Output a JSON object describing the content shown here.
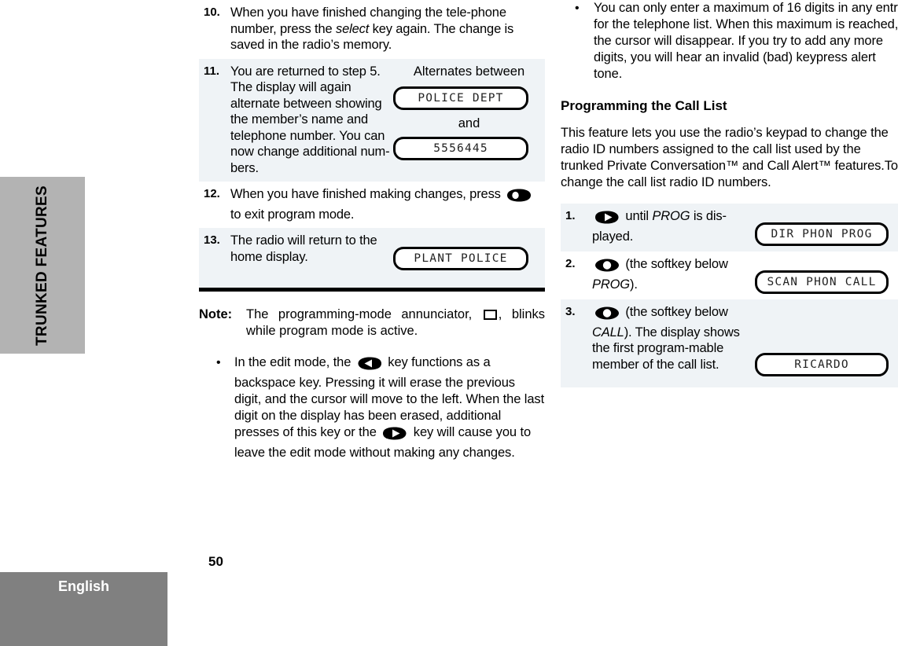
{
  "side_tab": {
    "label": "TRUNKED FEATURES"
  },
  "footer": {
    "language": "English",
    "page_number": "50"
  },
  "left_column": {
    "steps": [
      {
        "number": "10.",
        "shaded": false,
        "text_a": "When you have finished changing the tele-phone number, press the ",
        "text_italic": "select",
        "text_b": " key again. The change is saved in the radio’s memory."
      },
      {
        "number": "11.",
        "shaded": true,
        "text": "You are returned to step 5. The display will again alternate between showing the member’s name and telephone number. You can now change additional num-bers.",
        "aux_caption": "Alternates between",
        "lcd_1": "POLICE DEPT",
        "aux_and": "and",
        "lcd_2": "5556445"
      },
      {
        "number": "12.",
        "shaded": false,
        "text_a": "When you have finished making changes, press ",
        "icon": "home-key-icon",
        "text_b": " to exit program mode."
      },
      {
        "number": "13.",
        "shaded": true,
        "text": "The radio will return to the home display.",
        "lcd_1": "PLANT POLICE"
      }
    ],
    "note": {
      "label": "Note:",
      "text_a": "The programming-mode annunciator, ",
      "icon": "annunciator-icon",
      "text_b": ", blinks while program mode is active."
    },
    "bullet": {
      "mark": "•",
      "text_a": "In the edit mode, the ",
      "icon_1": "left-arrow-key-icon",
      "text_b": " key functions as a backspace key. Pressing it will erase the previous digit, and the cursor will move to the left. When the last digit on the display has been erased, additional presses of this key or the ",
      "icon_2": "right-arrow-key-icon",
      "text_c": " key will cause you to leave the edit mode without making any changes."
    }
  },
  "right_column": {
    "bullet": {
      "mark": "•",
      "text": "You can only enter a maximum of 16 digits in any entry for the telephone list. When this maximum is reached, the cursor will disappear. If you try to add any more digits, you will hear an invalid (bad) keypress alert tone."
    },
    "section_heading": "Programming the Call List",
    "body_paragraph": "This feature lets you use the radio’s keypad to change the radio ID numbers assigned to the call list used by the trunked Private Conversation™ and Call Alert™ features.To change the call list radio ID numbers.",
    "steps": [
      {
        "number": "1.",
        "shaded": true,
        "icon": "right-arrow-key-icon",
        "text_a": " until ",
        "text_italic": "PROG",
        "text_b": " is dis-played.",
        "lcd": "DIR  PHON  PROG"
      },
      {
        "number": "2.",
        "shaded": false,
        "icon": "softkey-icon",
        "text_a": " (the softkey below ",
        "text_italic": "PROG",
        "text_b": ").",
        "lcd": "SCAN PHON  CALL"
      },
      {
        "number": "3.",
        "shaded": true,
        "icon": "softkey-icon",
        "text_a": " (the softkey below ",
        "text_italic": "CALL",
        "text_b": "). The display shows the first program-mable member of the call list.",
        "lcd": "RICARDO"
      }
    ]
  },
  "colors": {
    "tab_gray": "#b3b3b3",
    "footer_gray": "#808080",
    "row_shade": "#eff3f6",
    "text_black": "#000000"
  }
}
